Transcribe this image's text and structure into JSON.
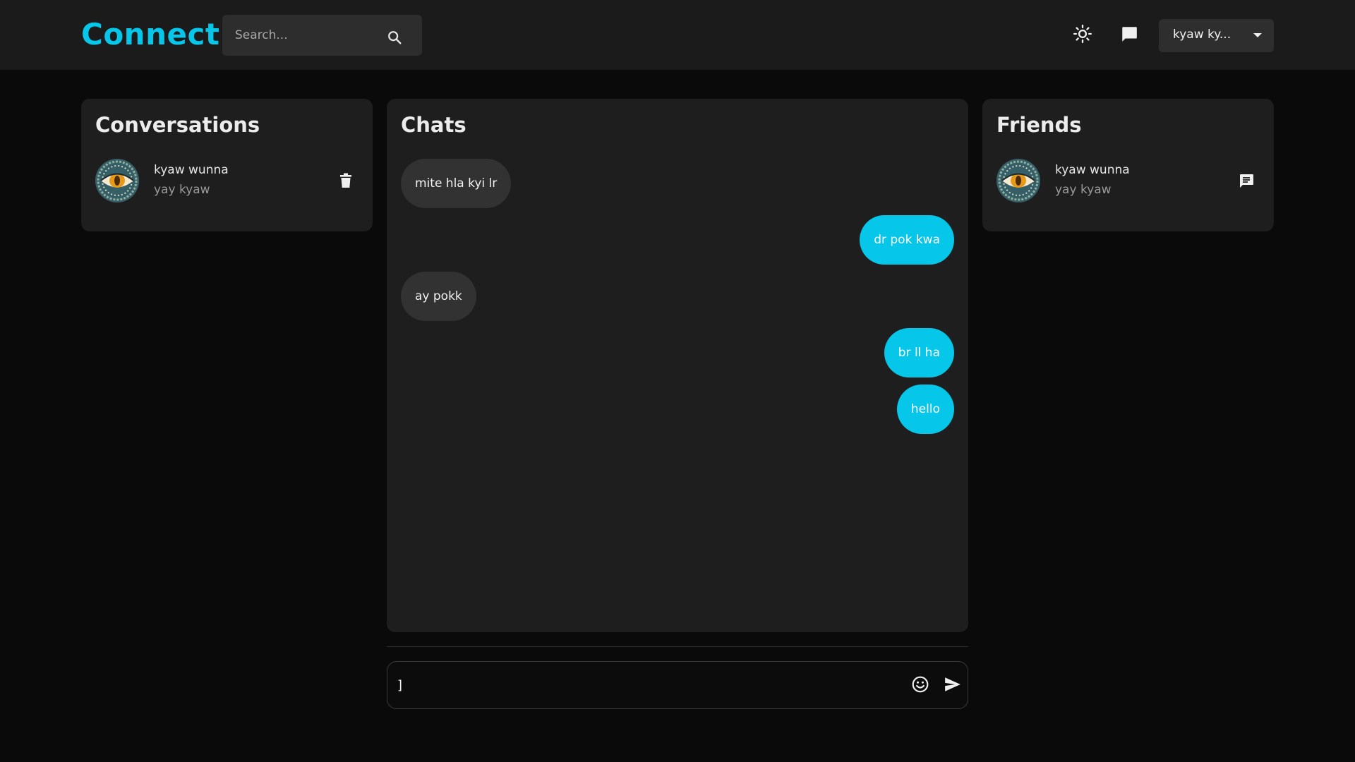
{
  "header": {
    "logo": "Connect",
    "search_placeholder": "Search...",
    "user_menu_label": "kyaw ky..."
  },
  "icons": {
    "search": "search-icon",
    "theme": "sun-icon",
    "messages": "chat-bubble-icon",
    "dropdown": "caret-down-icon",
    "delete": "trash-icon",
    "message_friend": "message-icon",
    "emoji": "smile-icon",
    "send": "send-icon"
  },
  "colors": {
    "accent": "#06c6ea",
    "background": "#0a0a0a",
    "panel": "#1e1e1e",
    "topbar": "#1b1b1b",
    "incoming_bubble": "#323232"
  },
  "conversations": {
    "title": "Conversations",
    "items": [
      {
        "name": "kyaw wunna",
        "subtitle": "yay kyaw"
      }
    ]
  },
  "chats": {
    "title": "Chats",
    "messages": [
      {
        "text": "mite hla kyi lr",
        "direction": "incoming"
      },
      {
        "text": "dr pok kwa",
        "direction": "outgoing"
      },
      {
        "text": "ay pokk",
        "direction": "incoming"
      },
      {
        "text": "br ll ha",
        "direction": "outgoing"
      },
      {
        "text": "hello",
        "direction": "outgoing"
      }
    ]
  },
  "friends": {
    "title": "Friends",
    "items": [
      {
        "name": "kyaw wunna",
        "subtitle": "yay kyaw"
      }
    ]
  },
  "composer": {
    "value": "]"
  }
}
